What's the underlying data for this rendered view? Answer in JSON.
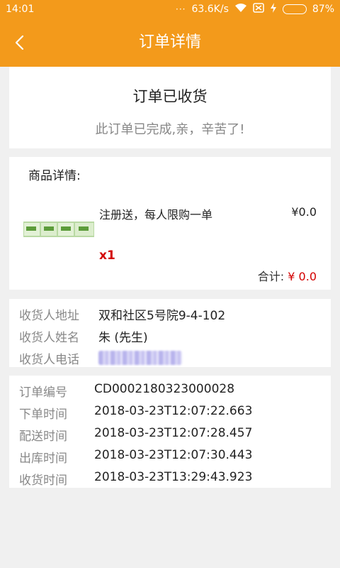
{
  "status_bar": {
    "time": "14:01",
    "dots": "···",
    "network_speed": "63.6K/s",
    "battery": "87%",
    "battery_level": 0.87
  },
  "header": {
    "title": "订单详情",
    "back_icon": "chevron-left-icon"
  },
  "order_status": {
    "title": "订单已收货",
    "message": "此订单已完成,亲，辛苦了!"
  },
  "goods": {
    "section_title": "商品详情:",
    "items": [
      {
        "name": "注册送，每人限购一单",
        "price": "¥0.0",
        "quantity": "x1"
      }
    ],
    "total_label": "合计:",
    "total_value": "¥ 0.0"
  },
  "receiver": {
    "address_label": "收货人地址",
    "address": "双和社区5号院9-4-102",
    "name_label": "收货人姓名",
    "name": "朱 (先生)",
    "phone_label": "收货人电话"
  },
  "order_info": {
    "rows": [
      {
        "label": "订单编号",
        "value": "CD0002180323000028"
      },
      {
        "label": "下单时间",
        "value": "2018-03-23T12:07:22.663"
      },
      {
        "label": "配送时间",
        "value": "2018-03-23T12:07:28.457"
      },
      {
        "label": "出库时间",
        "value": "2018-03-23T12:07:30.443"
      },
      {
        "label": "收货时间",
        "value": "2018-03-23T13:29:43.923"
      }
    ]
  },
  "colors": {
    "accent": "#f39a1b",
    "price_red": "#d30000"
  }
}
